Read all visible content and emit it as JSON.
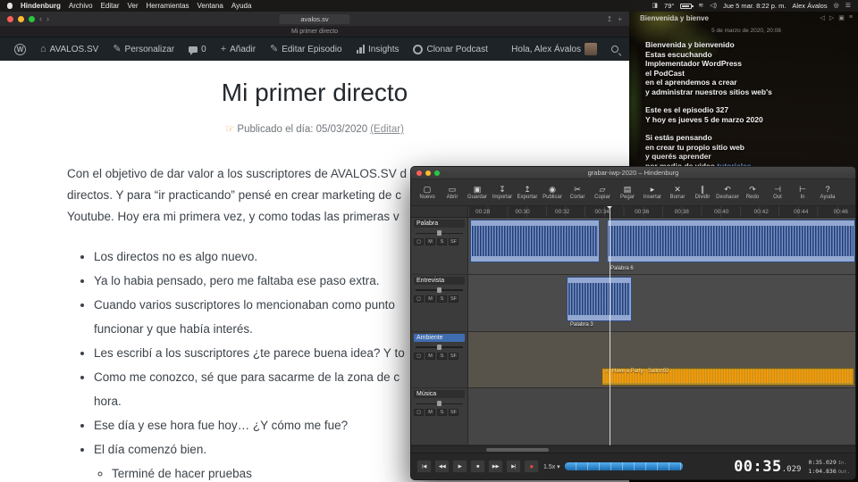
{
  "menubar": {
    "app_name": "Hindenburg",
    "items": [
      "Archivo",
      "Editar",
      "Ver",
      "Herramientas",
      "Ventana",
      "Ayuda"
    ],
    "temp": "79°",
    "datetime": "Jue 5 mar.  8:22 p. m.",
    "user": "Alex Ávalos"
  },
  "browser": {
    "url": "avalos.sv",
    "tab_title": "Mi primer directo"
  },
  "admin_bar": {
    "site": "AVALOS.SV",
    "personalize": "Personalizar",
    "comments_count": "0",
    "add_new": "Añadir",
    "edit": "Editar Episodio",
    "insights": "Insights",
    "clone": "Clonar Podcast",
    "greeting": "Hola, Alex Ávalos"
  },
  "article": {
    "title": "Mi primer directo",
    "meta_pointer": "☞",
    "meta_text": "Publicado el día: 05/03/2020",
    "meta_link": "(Editar)",
    "paragraph_lines": [
      "Con el objetivo de dar valor a los suscriptores de AVALOS.SV d",
      "directos. Y para “ir practicando” pensé en crear marketing de c",
      "Youtube. Hoy era mi primera vez, y como todas las primeras v"
    ],
    "bullets": [
      [
        "Los directos no es algo nuevo."
      ],
      [
        "Ya lo habia pensado, pero me faltaba ese paso extra."
      ],
      [
        "Cuando varios suscriptores lo mencionaban como punto",
        "funcionar y que había interés."
      ],
      [
        "Les escribí a los suscriptores ¿te parece buena idea? Y to"
      ],
      [
        "Como me conozco, sé que para sacarme de la zona de c",
        "hora."
      ],
      [
        "Ese día y ese hora fue hoy… ¿Y cómo me fue?"
      ],
      [
        "El día comenzó bien."
      ]
    ],
    "sub_bullet": "Terminé de hacer pruebas"
  },
  "wallpaper": {
    "partial_top": "Bienvenida y bienve",
    "timestamp": "5 de marzo de 2020, 20:08",
    "block1": [
      "Bienvenida y bienvenido",
      "Estas escuchando",
      "Implementador WordPress",
      "el PodCast",
      "en el aprendemos a crear",
      "y administrar nuestros sitios web's"
    ],
    "block2": [
      "Este es el episodio 327",
      "Y hoy es jueves 5 de marzo 2020"
    ],
    "block3_lines": [
      "Si estás pensando",
      "en crear tu propio sitio web",
      "y querés aprender"
    ],
    "block3_last_prefix": "por medio de video ",
    "block3_last_link": "tutoriales"
  },
  "hindenburg": {
    "window_title": "grabar-iwp-2020 – Hindenburg",
    "toolbar": [
      {
        "icon": "▢",
        "label": "Nuevo"
      },
      {
        "icon": "▭",
        "label": "Abrir"
      },
      {
        "icon": "▣",
        "label": "Guardar"
      },
      {
        "icon": "↧",
        "label": "Importar"
      },
      {
        "icon": "↥",
        "label": "Exportar"
      },
      {
        "icon": "◉",
        "label": "Publicar"
      },
      {
        "icon": "✂",
        "label": "Cortar"
      },
      {
        "icon": "▱",
        "label": "Copiar"
      },
      {
        "icon": "▤",
        "label": "Pegar"
      },
      {
        "icon": "▸",
        "label": "Insertar"
      },
      {
        "icon": "✕",
        "label": "Borrar"
      },
      {
        "icon": "∥",
        "label": "Dividir"
      },
      {
        "icon": "↶",
        "label": "Deshacer"
      },
      {
        "icon": "↷",
        "label": "Redo"
      },
      {
        "icon": "⊣",
        "label": "Out"
      },
      {
        "icon": "⊢",
        "label": "In"
      },
      {
        "icon": "?",
        "label": "Ayuda"
      }
    ],
    "ruler": [
      "00:28",
      "00:30",
      "00:32",
      "00:34",
      "00:36",
      "00:38",
      "00:40",
      "00:42",
      "00:44",
      "00:46"
    ],
    "tracks": [
      "Palabra",
      "Entrevista",
      "Ambiente",
      "Música"
    ],
    "track_buttons": [
      "◻",
      "M",
      "S",
      "SF"
    ],
    "clips": {
      "palabra_b_label": "Palabra 6",
      "entrevista_label": "Palabra 3",
      "ambiente_label": "♪ I Have a Party - Salinn92"
    },
    "transport": {
      "buttons": [
        "|◀",
        "◀◀",
        "▶",
        "■",
        "▶▶",
        "▶|"
      ],
      "record": "●",
      "speed": "1.5x ▾",
      "time_main": "00:35",
      "time_ms": ".029",
      "in_value": "0:35.029",
      "in_label": "In.",
      "out_value": "1:04.836",
      "out_label": "Out."
    }
  }
}
